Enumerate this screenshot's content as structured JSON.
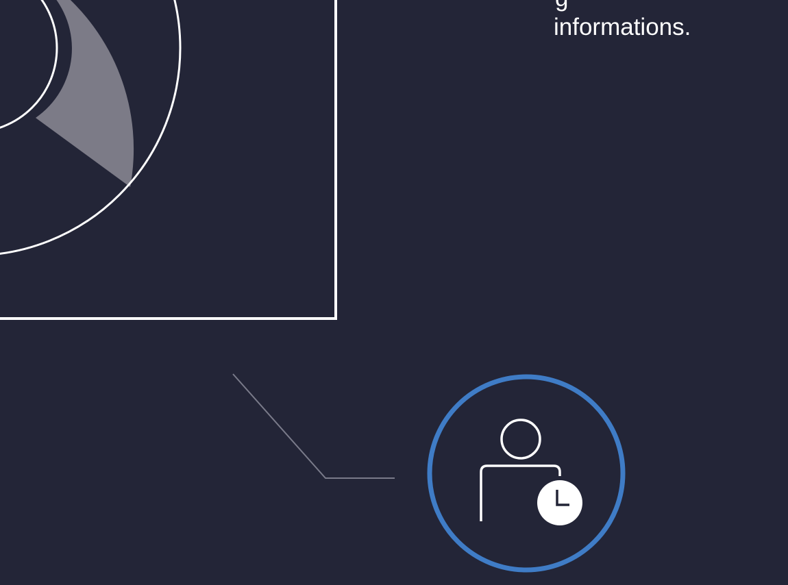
{
  "caption": {
    "fragment": "g",
    "line": "informations."
  },
  "colors": {
    "background": "#232537",
    "ring_fill": "#7c7b87",
    "stroke": "#ffffff",
    "badge_ring": "#3f7cc6",
    "connector": "#7a7b8a"
  },
  "icons": {
    "badge": "user-clock-icon"
  }
}
